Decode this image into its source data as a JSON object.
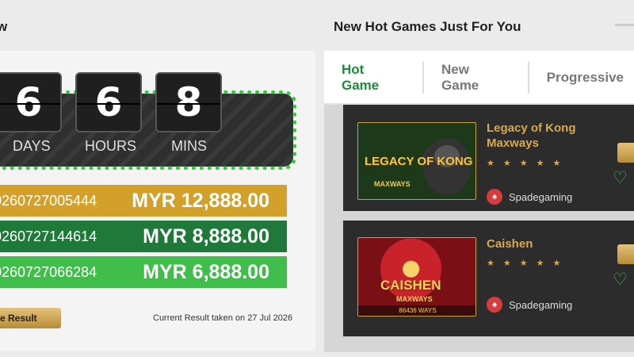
{
  "left": {
    "title": "w",
    "countdown": [
      {
        "digit": "6",
        "unit": "DAYS"
      },
      {
        "digit": "6",
        "unit": "HOURS"
      },
      {
        "digit": "8",
        "unit": "MINS"
      }
    ],
    "results": [
      {
        "number": "0260727005444",
        "amount": "MYR 12,888.00",
        "color": "#d3a12a"
      },
      {
        "number": "0260727144614",
        "amount": "MYR 8,888.00",
        "color": "#1f7a3a"
      },
      {
        "number": "0260727066284",
        "amount": "MYR 6,888.00",
        "color": "#3fbf49"
      }
    ],
    "result_button": "e Result",
    "taken_text": "Current Result taken on 27 Jul 2026"
  },
  "right": {
    "title": "New Hot Games Just For You",
    "tabs": [
      "Hot Game",
      "New Game",
      "Progressive"
    ],
    "games": [
      {
        "name": "Legacy of Kong Maxways",
        "stars": "★★★★★",
        "provider": "Spadegaming",
        "thumb_text": "LEGACY OF KONG",
        "thumb_sub": "MAXWAYS"
      },
      {
        "name": "Caishen",
        "stars": "★★★★★",
        "provider": "Spadegaming",
        "thumb_text": "CAISHEN",
        "thumb_sub": "MAXWAYS",
        "thumb_ways": "86436 WAYS"
      }
    ]
  },
  "colors": {
    "accent_green": "#1a8a3b",
    "gold": "#d8a94d",
    "dot_green": "#2ed039"
  }
}
